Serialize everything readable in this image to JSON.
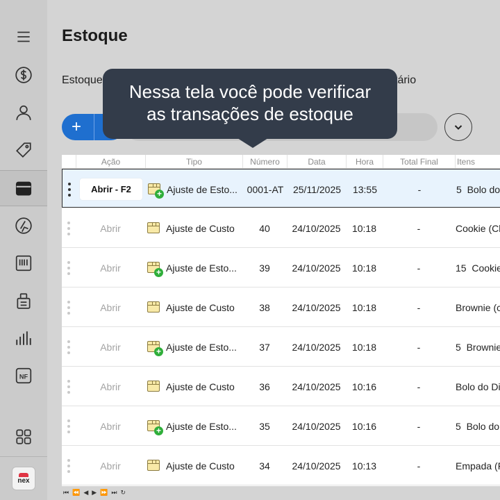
{
  "page": {
    "title": "Estoque",
    "subnav_left": "Estoque",
    "subnav_right": "tário"
  },
  "tooltip": {
    "line1": "Nessa tela você pode verificar",
    "line2": "as transações de estoque"
  },
  "toolbar": {
    "add_label": "+"
  },
  "sidebar": {
    "items": [
      {
        "icon": "menu-icon"
      },
      {
        "icon": "dollar-icon"
      },
      {
        "icon": "user-icon"
      },
      {
        "icon": "tag-icon"
      },
      {
        "icon": "box-icon",
        "active": true
      },
      {
        "icon": "ingredients-icon"
      },
      {
        "icon": "barcode-icon"
      },
      {
        "icon": "clipboard-icon"
      },
      {
        "icon": "bar-chart-icon"
      },
      {
        "icon": "nf-icon",
        "label": "NF"
      },
      {
        "icon": "grid-icon"
      }
    ],
    "logo_text": "nex"
  },
  "table": {
    "columns": [
      "Ação",
      "Tipo",
      "Número",
      "Data",
      "Hora",
      "Total Final",
      "Itens"
    ],
    "rows": [
      {
        "acao": "Abrir - F2",
        "tipo": "Ajuste de Esto...",
        "numero": "0001-AT",
        "data": "25/11/2025",
        "hora": "13:55",
        "total": "-",
        "itens": "5  Bolo do",
        "badge": true,
        "selected": true
      },
      {
        "acao": "Abrir",
        "tipo": "Ajuste de Custo",
        "numero": "40",
        "data": "24/10/2025",
        "hora": "10:18",
        "total": "-",
        "itens": "Cookie (Ch",
        "badge": false
      },
      {
        "acao": "Abrir",
        "tipo": "Ajuste de Esto...",
        "numero": "39",
        "data": "24/10/2025",
        "hora": "10:18",
        "total": "-",
        "itens": "15  Cookie",
        "badge": true
      },
      {
        "acao": "Abrir",
        "tipo": "Ajuste de Custo",
        "numero": "38",
        "data": "24/10/2025",
        "hora": "10:18",
        "total": "-",
        "itens": "Brownie (c",
        "badge": false
      },
      {
        "acao": "Abrir",
        "tipo": "Ajuste de Esto...",
        "numero": "37",
        "data": "24/10/2025",
        "hora": "10:18",
        "total": "-",
        "itens": "5  Brownie",
        "badge": true
      },
      {
        "acao": "Abrir",
        "tipo": "Ajuste de Custo",
        "numero": "36",
        "data": "24/10/2025",
        "hora": "10:16",
        "total": "-",
        "itens": "Bolo do Di",
        "badge": false
      },
      {
        "acao": "Abrir",
        "tipo": "Ajuste de Esto...",
        "numero": "35",
        "data": "24/10/2025",
        "hora": "10:16",
        "total": "-",
        "itens": "5  Bolo do",
        "badge": true
      },
      {
        "acao": "Abrir",
        "tipo": "Ajuste de Custo",
        "numero": "34",
        "data": "24/10/2025",
        "hora": "10:13",
        "total": "-",
        "itens": "Empada (F",
        "badge": false
      }
    ]
  },
  "pager": [
    "⏮",
    "⏪",
    "◀",
    "▶",
    "⏩",
    "⏭",
    "↻"
  ]
}
